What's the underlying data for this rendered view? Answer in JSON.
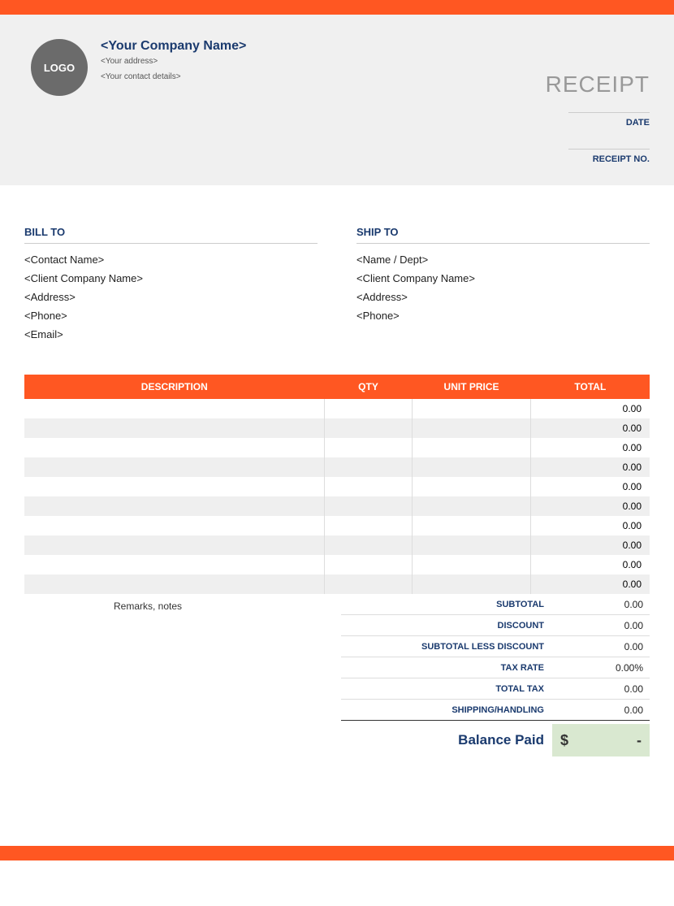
{
  "header": {
    "logo_text": "LOGO",
    "company_name": "<Your Company Name>",
    "address": "<Your address>",
    "contact": "<Your contact details>",
    "title": "RECEIPT",
    "date_label": "DATE",
    "receipt_no_label": "RECEIPT NO."
  },
  "bill_to": {
    "heading": "BILL TO",
    "contact": "<Contact Name>",
    "company": "<Client Company Name>",
    "address": "<Address>",
    "phone": "<Phone>",
    "email": "<Email>"
  },
  "ship_to": {
    "heading": "SHIP TO",
    "name": "<Name / Dept>",
    "company": "<Client Company Name>",
    "address": "<Address>",
    "phone": "<Phone>"
  },
  "columns": {
    "description": "DESCRIPTION",
    "qty": "QTY",
    "unit_price": "UNIT PRICE",
    "total": "TOTAL"
  },
  "items": [
    {
      "description": "",
      "qty": "",
      "unit_price": "",
      "total": "0.00"
    },
    {
      "description": "",
      "qty": "",
      "unit_price": "",
      "total": "0.00"
    },
    {
      "description": "",
      "qty": "",
      "unit_price": "",
      "total": "0.00"
    },
    {
      "description": "",
      "qty": "",
      "unit_price": "",
      "total": "0.00"
    },
    {
      "description": "",
      "qty": "",
      "unit_price": "",
      "total": "0.00"
    },
    {
      "description": "",
      "qty": "",
      "unit_price": "",
      "total": "0.00"
    },
    {
      "description": "",
      "qty": "",
      "unit_price": "",
      "total": "0.00"
    },
    {
      "description": "",
      "qty": "",
      "unit_price": "",
      "total": "0.00"
    },
    {
      "description": "",
      "qty": "",
      "unit_price": "",
      "total": "0.00"
    },
    {
      "description": "",
      "qty": "",
      "unit_price": "",
      "total": "0.00"
    }
  ],
  "remarks_label": "Remarks, notes",
  "summary": {
    "subtotal_label": "SUBTOTAL",
    "subtotal": "0.00",
    "discount_label": "DISCOUNT",
    "discount": "0.00",
    "subless_label": "SUBTOTAL LESS DISCOUNT",
    "subless": "0.00",
    "taxrate_label": "TAX RATE",
    "taxrate": "0.00%",
    "totaltax_label": "TOTAL TAX",
    "totaltax": "0.00",
    "shipping_label": "SHIPPING/HANDLING",
    "shipping": "0.00",
    "balance_label": "Balance Paid",
    "balance_currency": "$",
    "balance_amount": "-"
  }
}
